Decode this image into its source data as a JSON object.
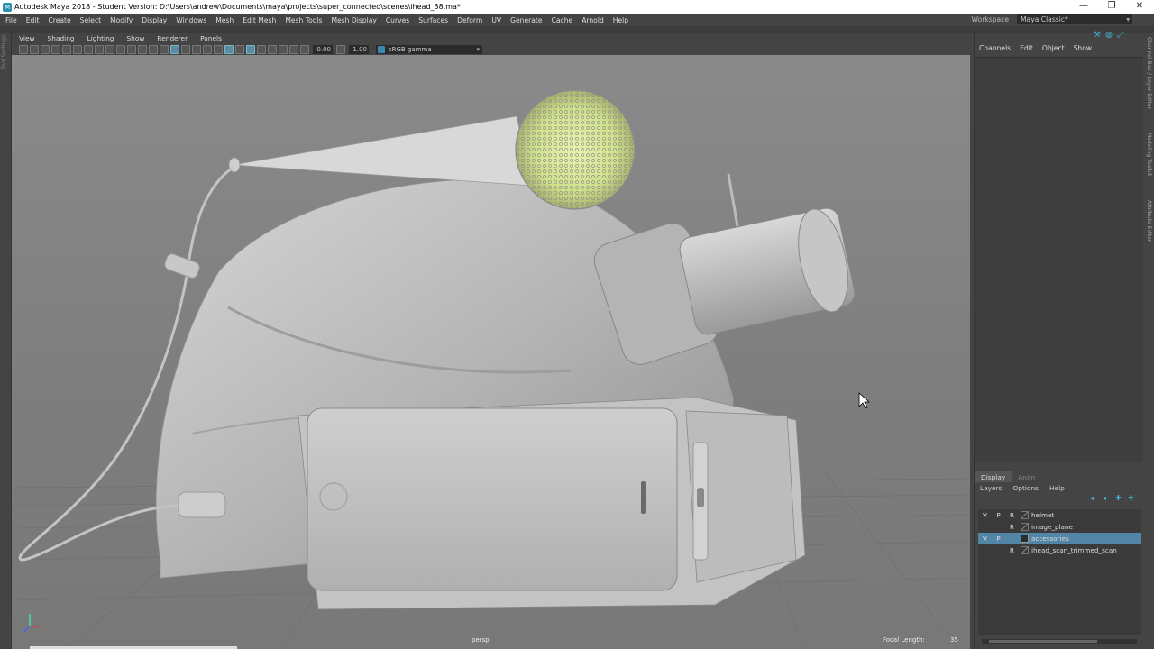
{
  "window": {
    "title": "Autodesk Maya 2018 - Student Version: D:\\Users\\andrew\\Documents\\maya\\projects\\super_connected\\scenes\\ihead_38.ma*",
    "icon_glyph": "M",
    "minimize_glyph": "—",
    "restore_glyph": "❐",
    "close_glyph": "✕"
  },
  "menubar": {
    "items": [
      "File",
      "Edit",
      "Create",
      "Select",
      "Modify",
      "Display",
      "Windows",
      "Mesh",
      "Edit Mesh",
      "Mesh Tools",
      "Mesh Display",
      "Curves",
      "Surfaces",
      "Deform",
      "UV",
      "Generate",
      "Cache",
      "Arnold",
      "Help"
    ]
  },
  "workspace": {
    "label": "Workspace :",
    "value": "Maya Classic*"
  },
  "toolbox": {
    "tool_settings_label": "Tool Settings"
  },
  "viewport": {
    "menus": [
      "View",
      "Shading",
      "Lighting",
      "Show",
      "Renderer",
      "Panels"
    ],
    "field_a": "0.00",
    "field_b": "1.00",
    "color_mgmt": "sRGB gamma",
    "camera_label": "persp",
    "focal_label": "Focal Length:",
    "focal_value": "35"
  },
  "channel_box": {
    "tabs": [
      "Channels",
      "Edit",
      "Object",
      "Show"
    ]
  },
  "layer_editor": {
    "tabs": [
      "Display",
      "Anim"
    ],
    "menus": [
      "Layers",
      "Options",
      "Help"
    ],
    "layers": [
      {
        "v": "V",
        "p": "P",
        "r": "R",
        "name": "helmet",
        "selected": false,
        "swatch": "none"
      },
      {
        "v": "",
        "p": "",
        "r": "R",
        "name": "image_plane",
        "selected": false,
        "swatch": "none"
      },
      {
        "v": "V",
        "p": "P",
        "r": "",
        "name": "accessories",
        "selected": true,
        "swatch": "dark"
      },
      {
        "v": "",
        "p": "",
        "r": "R",
        "name": "ihead_scan_trimmed_scan",
        "selected": false,
        "swatch": "none"
      }
    ]
  },
  "side_tabs": [
    "Channel Box / Layer Editor",
    "Modeling Toolkit",
    "Attribute Editor"
  ]
}
